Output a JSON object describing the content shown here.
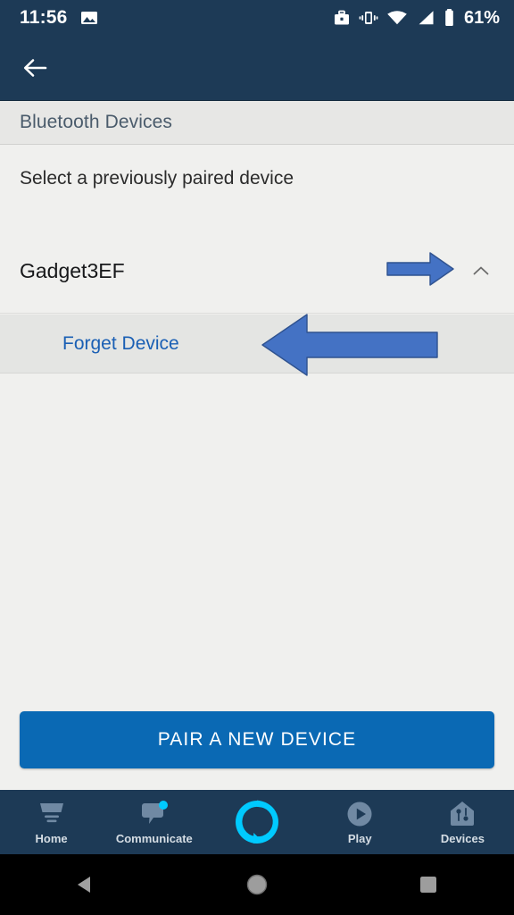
{
  "status_bar": {
    "time": "11:56",
    "battery_percent": "61%",
    "icons": [
      "image-icon",
      "work-briefcase-icon",
      "vibrate-icon",
      "wifi-icon",
      "cell-signal-icon",
      "battery-icon"
    ]
  },
  "app_bar": {
    "back_icon": "back-arrow-icon"
  },
  "section": {
    "header": "Bluetooth Devices",
    "subtitle": "Select a previously paired device"
  },
  "device": {
    "name": "Gadget3EF",
    "expand_icon": "chevron-up-icon",
    "forget_label": "Forget Device"
  },
  "annotations": [
    {
      "name": "arrow-pointing-to-chevron",
      "direction": "right",
      "color": "#4472c4"
    },
    {
      "name": "arrow-pointing-to-forget-device",
      "direction": "left",
      "color": "#4472c4"
    }
  ],
  "primary_button": {
    "label": "PAIR A NEW DEVICE",
    "color": "#0a69b4"
  },
  "bottom_nav": {
    "items": [
      {
        "label": "Home",
        "icon": "home-icon",
        "badge": false
      },
      {
        "label": "Communicate",
        "icon": "speech-bubble-icon",
        "badge": true
      },
      {
        "label": "",
        "icon": "alexa-ring-icon",
        "badge": false
      },
      {
        "label": "Play",
        "icon": "play-circle-icon",
        "badge": false
      },
      {
        "label": "Devices",
        "icon": "devices-house-icon",
        "badge": false
      }
    ],
    "badge_color": "#00caff",
    "alexa_color": "#00caff"
  },
  "android_nav": {
    "back": "android-back-icon",
    "home": "android-home-icon",
    "recents": "android-recents-icon"
  }
}
